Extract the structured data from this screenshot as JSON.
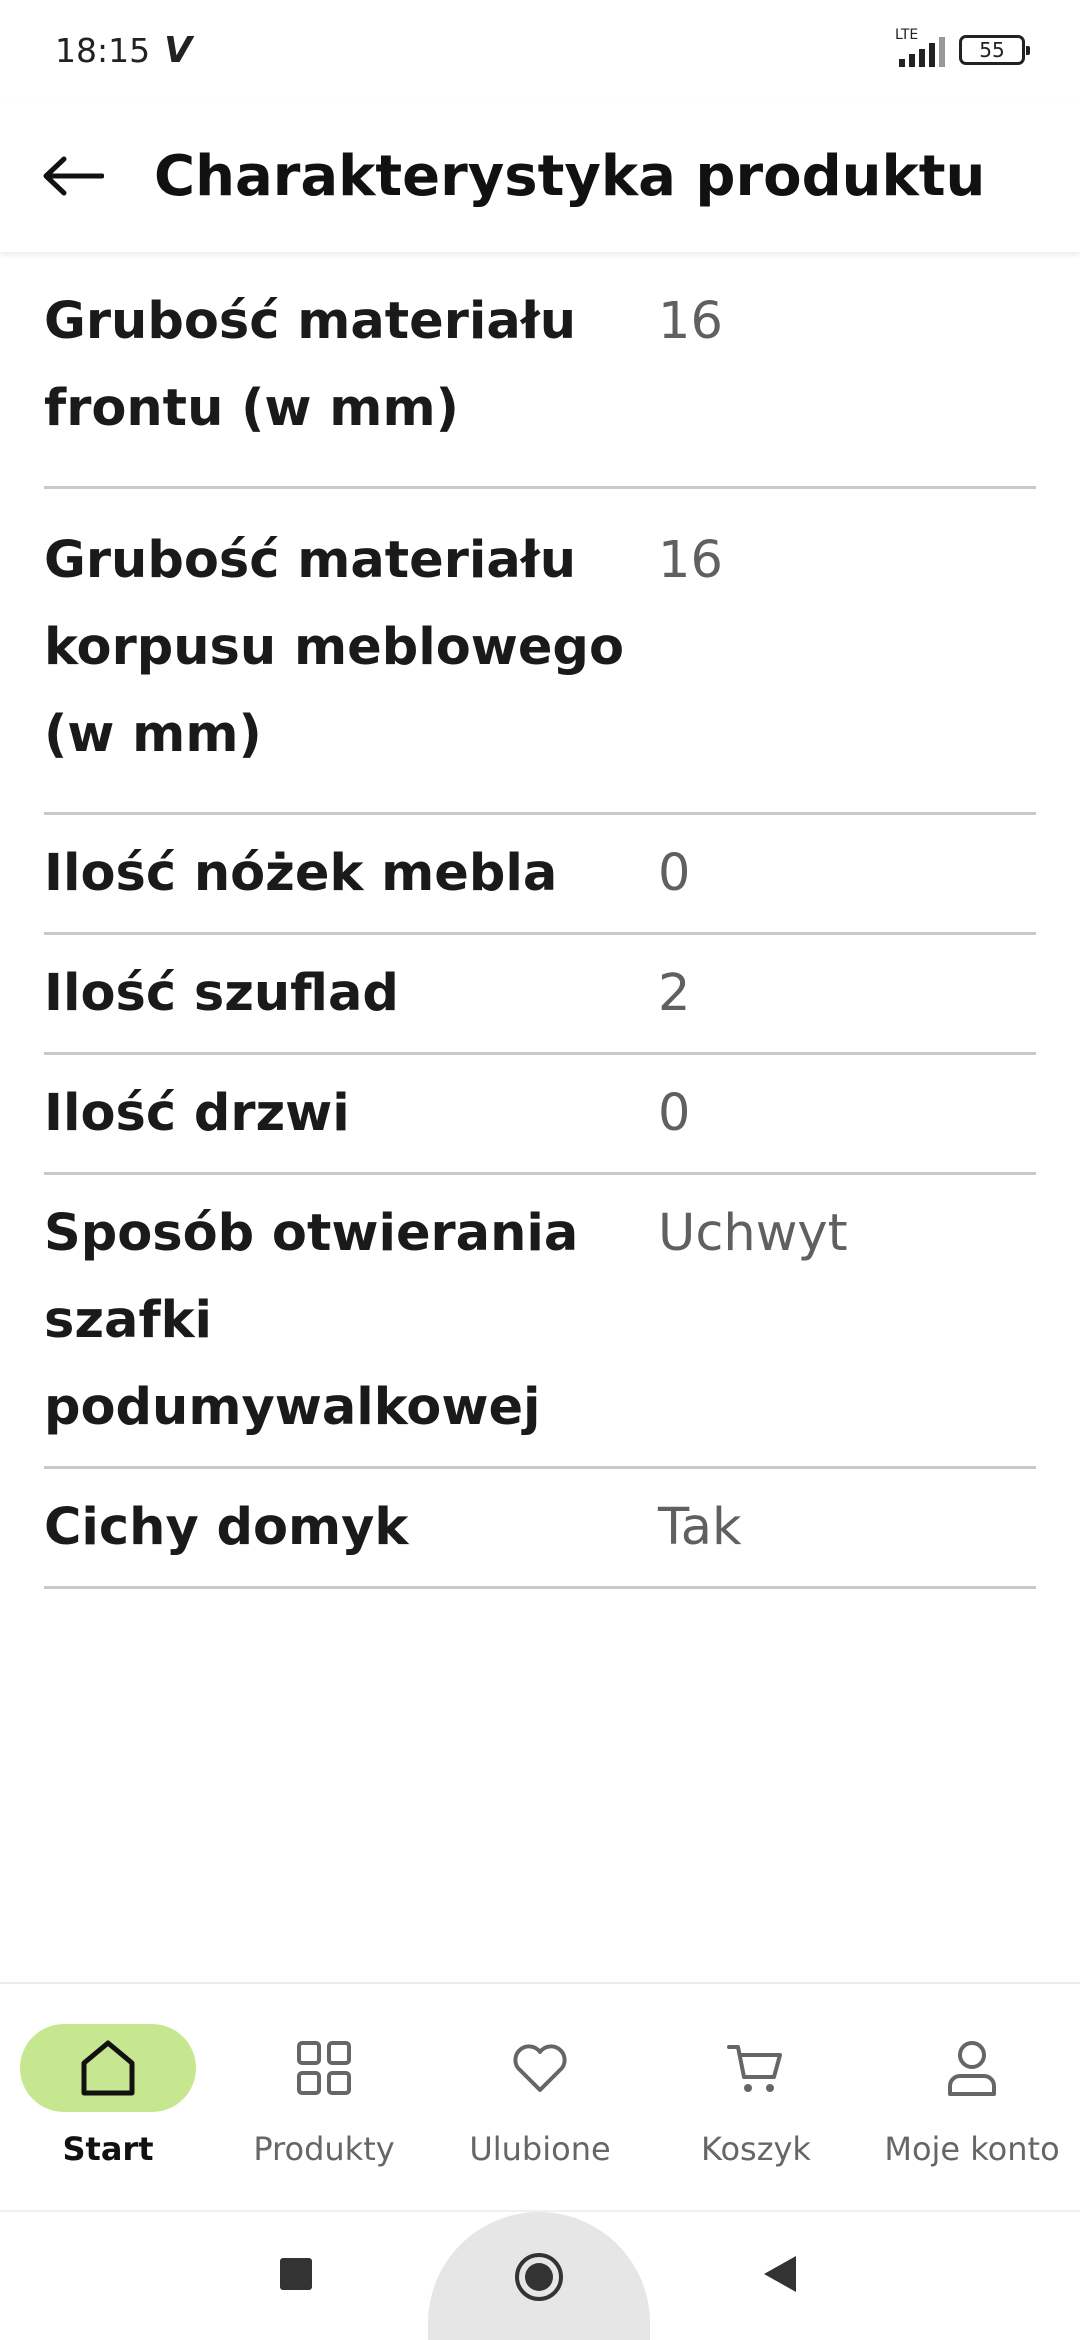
{
  "status_bar": {
    "time": "18:15",
    "carrier_icon": "V",
    "network": "LTE",
    "battery": "55"
  },
  "header": {
    "back_icon": "arrow-left-icon",
    "title": "Charakterystyka produktu"
  },
  "specs": [
    {
      "label": "Grubość materiału frontu (w mm)",
      "value": "16"
    },
    {
      "label": "Grubość materiału korpusu meblowego (w mm)",
      "value": "16"
    },
    {
      "label": "Ilość nóżek mebla",
      "value": "0"
    },
    {
      "label": "Ilość szuflad",
      "value": "2"
    },
    {
      "label": "Ilość drzwi",
      "value": "0"
    },
    {
      "label": "Sposób otwierania szafki podumywalkowej",
      "value": "Uchwyt"
    },
    {
      "label": "Cichy domyk",
      "value": "Tak"
    }
  ],
  "bottom_nav": {
    "accent": "#c6e68f",
    "items": [
      {
        "label": "Start",
        "icon": "home-icon",
        "active": true
      },
      {
        "label": "Produkty",
        "icon": "grid-icon",
        "active": false
      },
      {
        "label": "Ulubione",
        "icon": "heart-icon",
        "active": false
      },
      {
        "label": "Koszyk",
        "icon": "cart-icon",
        "active": false
      },
      {
        "label": "Moje konto",
        "icon": "user-icon",
        "active": false
      }
    ]
  }
}
